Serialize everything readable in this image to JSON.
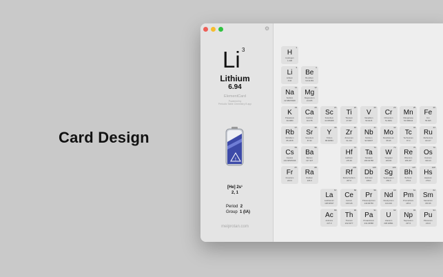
{
  "headline": "Card Design",
  "window": {
    "traffic_lights": {
      "close": "#ee5f57",
      "minimize": "#f6bd2f",
      "maximize": "#30c340"
    }
  },
  "selected": {
    "symbol": "Li",
    "number": "3",
    "name": "Lithium",
    "mass": "6.94",
    "app_name": "ElementCard",
    "powered_line1": "Powered by",
    "powered_line2": "Periodic Table Chemistry 8 app",
    "electron_config": "[He] 2s¹",
    "shells": "2, 1",
    "period_label": "Period",
    "period_value": "2",
    "group_label": "Group",
    "group_value": "1 (IA)",
    "site": "meiprotan.com"
  },
  "elements": [
    {
      "sym": "H",
      "num": "1",
      "name": "Hydrogen",
      "mass": "1.008"
    },
    {
      "sym": "Li",
      "num": "3",
      "name": "Lithium",
      "mass": "6.94"
    },
    {
      "sym": "Be",
      "num": "4",
      "name": "Beryllium",
      "mass": "9.012183"
    },
    {
      "sym": "Na",
      "num": "11",
      "name": "Sodium",
      "mass": "22.98976928"
    },
    {
      "sym": "Mg",
      "num": "12",
      "name": "Magnesium",
      "mass": "24.305"
    },
    {
      "sym": "K",
      "num": "19",
      "name": "Potassium",
      "mass": "39.0983"
    },
    {
      "sym": "Ca",
      "num": "20",
      "name": "Calcium",
      "mass": "40.078"
    },
    {
      "sym": "Sc",
      "num": "21",
      "name": "Scandium",
      "mass": "44.955908"
    },
    {
      "sym": "Ti",
      "num": "22",
      "name": "Titanium",
      "mass": "47.867"
    },
    {
      "sym": "V",
      "num": "23",
      "name": "Vanadium",
      "mass": "50.9415"
    },
    {
      "sym": "Cr",
      "num": "24",
      "name": "Chromium",
      "mass": "51.9961"
    },
    {
      "sym": "Mn",
      "num": "25",
      "name": "Manganese",
      "mass": "54.938044"
    },
    {
      "sym": "Fe",
      "num": "26",
      "name": "Iron",
      "mass": "55.845"
    },
    {
      "sym": "Rb",
      "num": "37",
      "name": "Rubidium",
      "mass": "85.4678"
    },
    {
      "sym": "Sr",
      "num": "38",
      "name": "Strontium",
      "mass": "87.62"
    },
    {
      "sym": "Y",
      "num": "39",
      "name": "Yttrium",
      "mass": "88.90584"
    },
    {
      "sym": "Zr",
      "num": "40",
      "name": "Zirconium",
      "mass": "91.224"
    },
    {
      "sym": "Nb",
      "num": "41",
      "name": "Niobium",
      "mass": "92.90637"
    },
    {
      "sym": "Mo",
      "num": "42",
      "name": "Molybdenum",
      "mass": "95.95"
    },
    {
      "sym": "Tc",
      "num": "43",
      "name": "Technetium",
      "mass": "97.0"
    },
    {
      "sym": "Ru",
      "num": "44",
      "name": "Ruthenium",
      "mass": "101.07"
    },
    {
      "sym": "Cs",
      "num": "55",
      "name": "Cesium",
      "mass": "132.90545196"
    },
    {
      "sym": "Ba",
      "num": "56",
      "name": "Barium",
      "mass": "137.327"
    },
    {
      "sym": "Hf",
      "num": "72",
      "name": "Hafnium",
      "mass": "178.49"
    },
    {
      "sym": "Ta",
      "num": "73",
      "name": "Tantalum",
      "mass": "180.94788"
    },
    {
      "sym": "W",
      "num": "74",
      "name": "Tungsten",
      "mass": "183.84"
    },
    {
      "sym": "Re",
      "num": "75",
      "name": "Rhenium",
      "mass": "186.207"
    },
    {
      "sym": "Os",
      "num": "76",
      "name": "Osmium",
      "mass": "190.23"
    },
    {
      "sym": "Fr",
      "num": "87",
      "name": "Francium",
      "mass": "223.0"
    },
    {
      "sym": "Ra",
      "num": "88",
      "name": "Radium",
      "mass": "226.0"
    },
    {
      "sym": "Rf",
      "num": "104",
      "name": "Rutherfordium",
      "mass": "267.0"
    },
    {
      "sym": "Db",
      "num": "105",
      "name": "Dubnium",
      "mass": "268.0"
    },
    {
      "sym": "Sg",
      "num": "106",
      "name": "Seaborgium",
      "mass": "269.0"
    },
    {
      "sym": "Bh",
      "num": "107",
      "name": "Bohrium",
      "mass": "270.0"
    },
    {
      "sym": "Hs",
      "num": "108",
      "name": "Hassium",
      "mass": "270.0"
    },
    {
      "sym": "La",
      "num": "57",
      "name": "Lanthanum",
      "mass": "138.90547"
    },
    {
      "sym": "Ce",
      "num": "58",
      "name": "Cerium",
      "mass": "140.116"
    },
    {
      "sym": "Pr",
      "num": "59",
      "name": "Praseodymium",
      "mass": "140.90766"
    },
    {
      "sym": "Nd",
      "num": "60",
      "name": "Neodymium",
      "mass": "144.242"
    },
    {
      "sym": "Pm",
      "num": "61",
      "name": "Promethium",
      "mass": "145.0"
    },
    {
      "sym": "Sm",
      "num": "62",
      "name": "Samarium",
      "mass": "150.36"
    },
    {
      "sym": "Ac",
      "num": "89",
      "name": "Actinium",
      "mass": "227.0"
    },
    {
      "sym": "Th",
      "num": "90",
      "name": "Thorium",
      "mass": "232.0377"
    },
    {
      "sym": "Pa",
      "num": "91",
      "name": "Protactinium",
      "mass": "231.03588"
    },
    {
      "sym": "U",
      "num": "92",
      "name": "Uranium",
      "mass": "238.02891"
    },
    {
      "sym": "Np",
      "num": "93",
      "name": "Neptunium",
      "mass": "237.0"
    },
    {
      "sym": "Pu",
      "num": "94",
      "name": "Plutonium",
      "mass": "244.0"
    }
  ]
}
